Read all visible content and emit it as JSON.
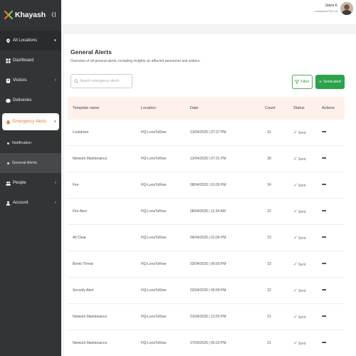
{
  "brand": {
    "name": "Khayash",
    "accent": "#e8762c"
  },
  "header": {
    "user_name": "Jakes K",
    "user_company": "Lenstorow Pvt Ltd"
  },
  "sidebar": {
    "location": "All Locations",
    "items": [
      {
        "label": "Dashboard",
        "icon": "dashboard-icon"
      },
      {
        "label": "Visitors",
        "icon": "visitors-icon"
      },
      {
        "label": "Deliveries",
        "icon": "deliveries-icon"
      },
      {
        "label": "Emergency Alerts",
        "icon": "emergency-icon"
      },
      {
        "label": "People",
        "icon": "people-icon"
      },
      {
        "label": "Account",
        "icon": "account-icon"
      }
    ],
    "sub_items": [
      {
        "label": "Notification"
      },
      {
        "label": "General Alerts"
      }
    ]
  },
  "page": {
    "title": "General Alerts",
    "subtitle": "Overview of all general alerts, including insights on affected personnel and visitors.",
    "search_placeholder": "Search emergency alerts",
    "filter_label": "Filter",
    "send_label": "Send alert"
  },
  "table": {
    "headers": [
      "Template name",
      "Location",
      "Date",
      "Count",
      "Status",
      "Actions"
    ],
    "rows": [
      {
        "name": "Lockdown",
        "location": "HQ-LensToRow",
        "date": "13/04/2026 | 07:37 PM",
        "count": "31",
        "status": "Sent"
      },
      {
        "name": "Network Maintenance",
        "location": "HQ-LensToRow",
        "date": "13/04/2026 | 07:31 PM",
        "count": "28",
        "status": "Sent"
      },
      {
        "name": "Fire",
        "location": "HQ-LensToRow",
        "date": "08/04/2026 | 01:06 PM",
        "count": "24",
        "status": "Sent"
      },
      {
        "name": "Fire Alert",
        "location": "HQ-LensToRow",
        "date": "08/04/2026 | 11:34 AM",
        "count": "22",
        "status": "Sent"
      },
      {
        "name": "All Clear",
        "location": "HQ-LensToRow",
        "date": "04/04/2026 | 01:04 PM",
        "count": "23",
        "status": "Sent"
      },
      {
        "name": "Bomb Threat",
        "location": "HQ-LensToRow",
        "date": "03/04/2026 | 06:59 PM",
        "count": "23",
        "status": "Sent"
      },
      {
        "name": "Security Alert",
        "location": "HQ-LensToRow",
        "date": "03/04/2026 | 06:58 PM",
        "count": "22",
        "status": "Sent"
      },
      {
        "name": "Network Maintenance",
        "location": "HQ-LensToRow",
        "date": "01/04/2026 | 12:55 PM",
        "count": "21",
        "status": "Sent"
      },
      {
        "name": "Network Maintenance",
        "location": "HQ-LensToRow",
        "date": "27/03/2026 | 06:20 PM",
        "count": "21",
        "status": "Sent"
      }
    ]
  },
  "colors": {
    "sidebar_bg": "#333436",
    "header_row_bg": "#fdf1ea",
    "success": "#2ba24c"
  }
}
